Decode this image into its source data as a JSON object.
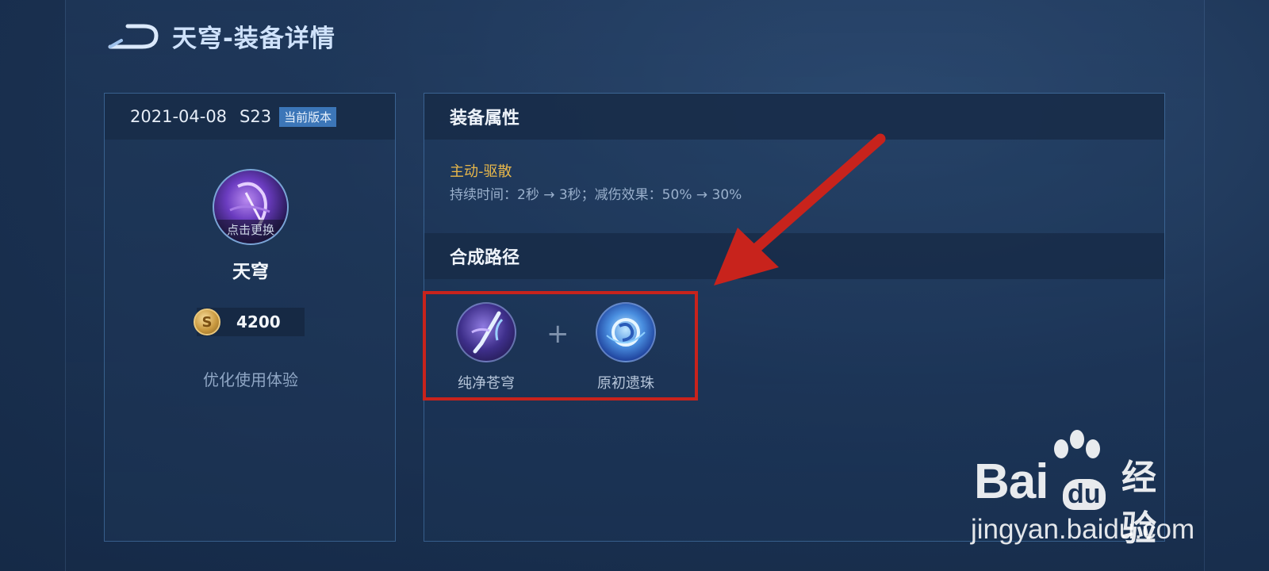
{
  "header": {
    "title": "天穹-装备详情"
  },
  "left": {
    "date": "2021-04-08",
    "season": "S23",
    "version_tag": "当前版本",
    "avatar_caption": "点击更换",
    "item_name": "天穹",
    "price": "4200",
    "description": "优化使用体验"
  },
  "attributes": {
    "title": "装备属性",
    "skill_name": "主动-驱散",
    "skill_desc": "持续时间：2秒 → 3秒；减伤效果：50% → 30%"
  },
  "recipe": {
    "title": "合成路径",
    "plus": "+",
    "components": [
      {
        "name": "纯净苍穹",
        "icon": "blade-icon"
      },
      {
        "name": "原初遗珠",
        "icon": "orb-icon"
      }
    ]
  },
  "watermark": {
    "brand": "Bai",
    "brand_suffix": "du",
    "product": "经验",
    "url": "jingyan.baidu.com"
  },
  "colors": {
    "accent_gold": "#e9b84a",
    "highlight_red": "#c8231c",
    "tag_blue": "#3c76b8"
  }
}
